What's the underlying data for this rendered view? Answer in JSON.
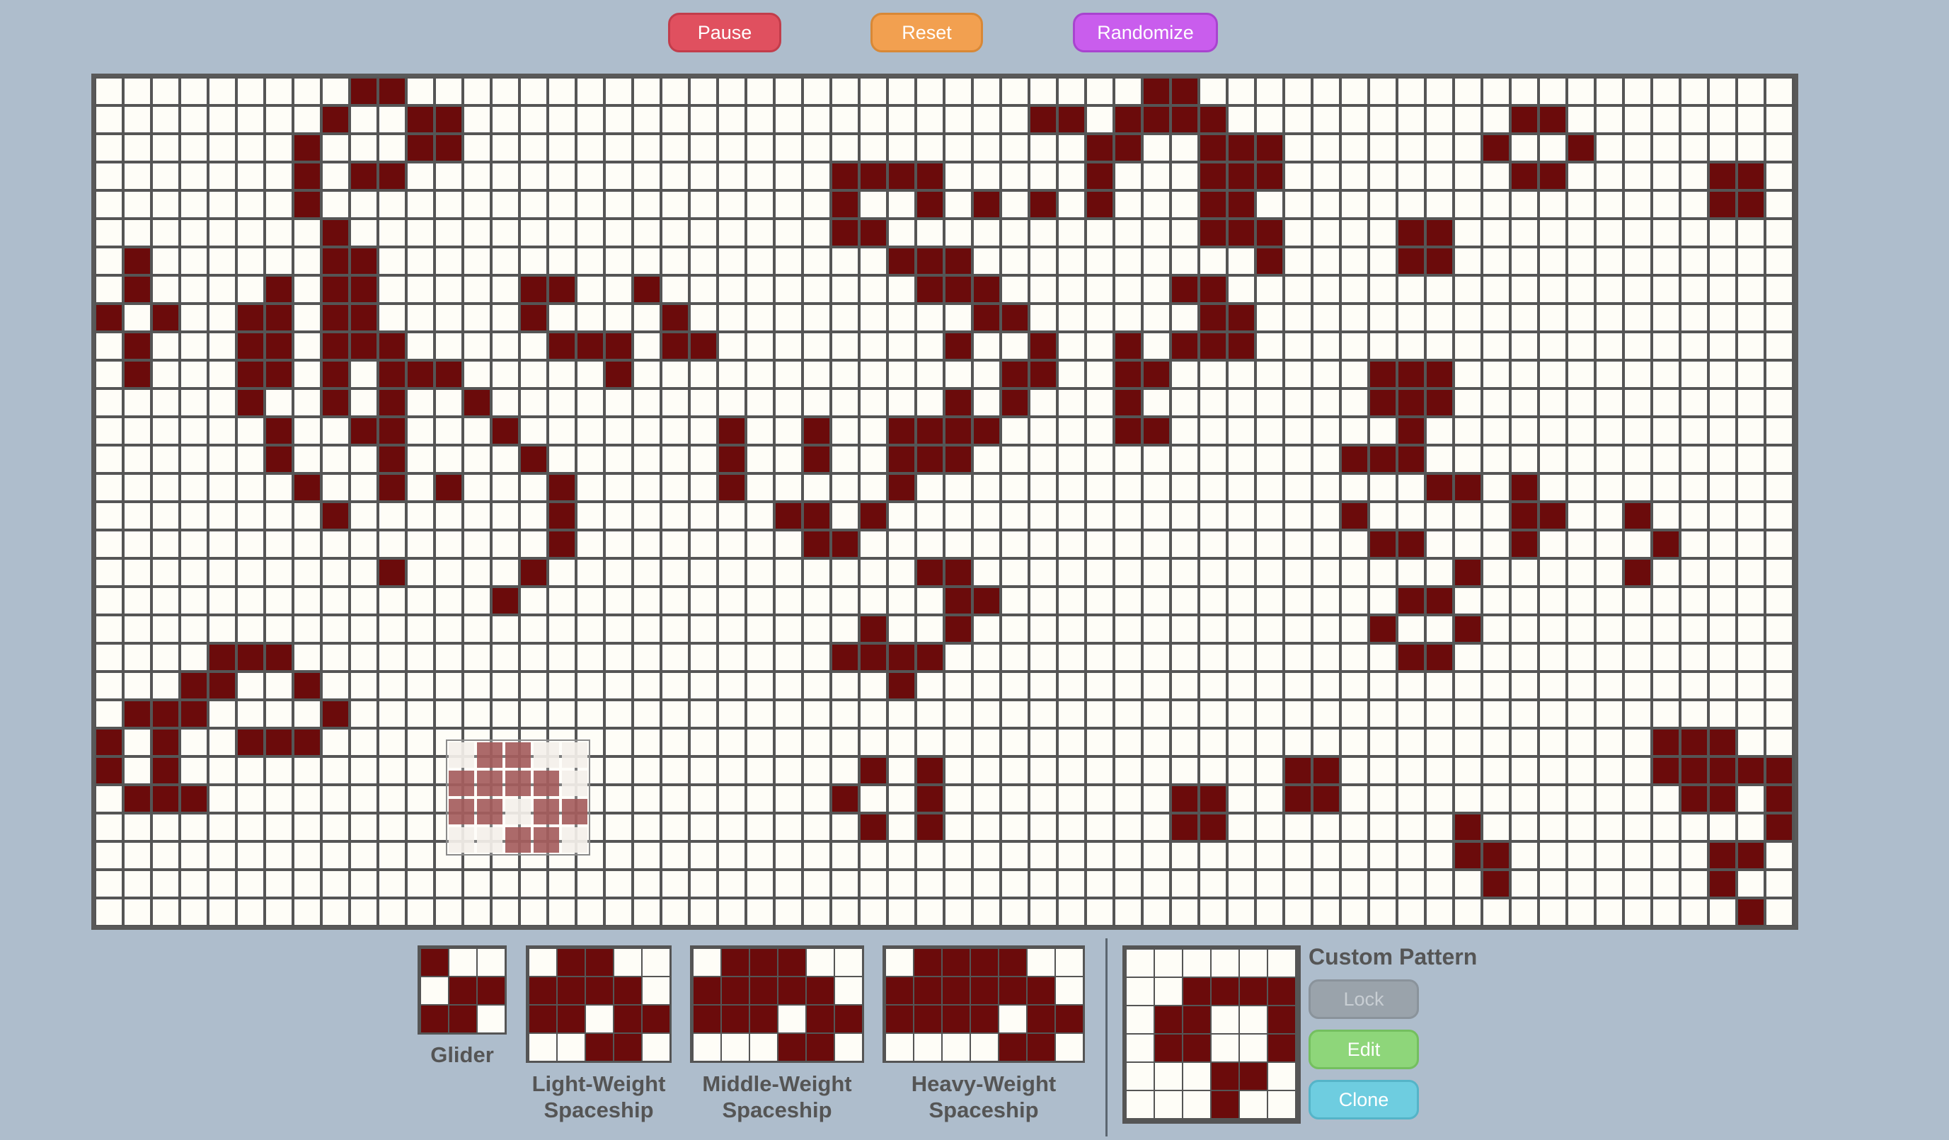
{
  "controls": {
    "pause_label": "Pause",
    "reset_label": "Reset",
    "randomize_label": "Randomize"
  },
  "colors": {
    "alive": "#6b0b0b",
    "dead": "#fefdf7",
    "grid": "#555555",
    "background": "#aebdcc"
  },
  "board": {
    "cols": 60,
    "rows": 30,
    "alive": [
      [
        0,
        9
      ],
      [
        0,
        10
      ],
      [
        0,
        37
      ],
      [
        0,
        38
      ],
      [
        1,
        8
      ],
      [
        1,
        11
      ],
      [
        1,
        12
      ],
      [
        1,
        33
      ],
      [
        1,
        34
      ],
      [
        1,
        36
      ],
      [
        1,
        37
      ],
      [
        1,
        38
      ],
      [
        1,
        39
      ],
      [
        1,
        50
      ],
      [
        1,
        51
      ],
      [
        2,
        7
      ],
      [
        2,
        11
      ],
      [
        2,
        12
      ],
      [
        2,
        35
      ],
      [
        2,
        36
      ],
      [
        2,
        39
      ],
      [
        2,
        40
      ],
      [
        2,
        41
      ],
      [
        2,
        49
      ],
      [
        2,
        52
      ],
      [
        3,
        7
      ],
      [
        3,
        9
      ],
      [
        3,
        10
      ],
      [
        3,
        26
      ],
      [
        3,
        27
      ],
      [
        3,
        28
      ],
      [
        3,
        29
      ],
      [
        3,
        35
      ],
      [
        3,
        39
      ],
      [
        3,
        40
      ],
      [
        3,
        41
      ],
      [
        3,
        50
      ],
      [
        3,
        51
      ],
      [
        3,
        57
      ],
      [
        3,
        58
      ],
      [
        4,
        7
      ],
      [
        4,
        26
      ],
      [
        4,
        29
      ],
      [
        4,
        31
      ],
      [
        4,
        33
      ],
      [
        4,
        35
      ],
      [
        4,
        39
      ],
      [
        4,
        40
      ],
      [
        4,
        57
      ],
      [
        4,
        58
      ],
      [
        5,
        8
      ],
      [
        5,
        26
      ],
      [
        5,
        27
      ],
      [
        5,
        39
      ],
      [
        5,
        40
      ],
      [
        5,
        41
      ],
      [
        5,
        46
      ],
      [
        5,
        47
      ],
      [
        6,
        1
      ],
      [
        6,
        8
      ],
      [
        6,
        9
      ],
      [
        6,
        28
      ],
      [
        6,
        29
      ],
      [
        6,
        30
      ],
      [
        6,
        41
      ],
      [
        6,
        46
      ],
      [
        6,
        47
      ],
      [
        7,
        1
      ],
      [
        7,
        6
      ],
      [
        7,
        8
      ],
      [
        7,
        9
      ],
      [
        7,
        15
      ],
      [
        7,
        16
      ],
      [
        7,
        19
      ],
      [
        7,
        29
      ],
      [
        7,
        30
      ],
      [
        7,
        31
      ],
      [
        7,
        38
      ],
      [
        7,
        39
      ],
      [
        8,
        0
      ],
      [
        8,
        2
      ],
      [
        8,
        5
      ],
      [
        8,
        6
      ],
      [
        8,
        8
      ],
      [
        8,
        9
      ],
      [
        8,
        15
      ],
      [
        8,
        20
      ],
      [
        8,
        31
      ],
      [
        8,
        32
      ],
      [
        8,
        39
      ],
      [
        8,
        40
      ],
      [
        9,
        1
      ],
      [
        9,
        5
      ],
      [
        9,
        6
      ],
      [
        9,
        8
      ],
      [
        9,
        9
      ],
      [
        9,
        10
      ],
      [
        9,
        16
      ],
      [
        9,
        17
      ],
      [
        9,
        18
      ],
      [
        9,
        20
      ],
      [
        9,
        21
      ],
      [
        9,
        30
      ],
      [
        9,
        33
      ],
      [
        9,
        36
      ],
      [
        9,
        38
      ],
      [
        9,
        39
      ],
      [
        9,
        40
      ],
      [
        10,
        1
      ],
      [
        10,
        5
      ],
      [
        10,
        6
      ],
      [
        10,
        8
      ],
      [
        10,
        10
      ],
      [
        10,
        11
      ],
      [
        10,
        12
      ],
      [
        10,
        18
      ],
      [
        10,
        32
      ],
      [
        10,
        33
      ],
      [
        10,
        36
      ],
      [
        10,
        37
      ],
      [
        10,
        45
      ],
      [
        10,
        46
      ],
      [
        10,
        47
      ],
      [
        11,
        5
      ],
      [
        11,
        8
      ],
      [
        11,
        10
      ],
      [
        11,
        13
      ],
      [
        11,
        30
      ],
      [
        11,
        32
      ],
      [
        11,
        36
      ],
      [
        11,
        45
      ],
      [
        11,
        46
      ],
      [
        11,
        47
      ],
      [
        12,
        6
      ],
      [
        12,
        9
      ],
      [
        12,
        10
      ],
      [
        12,
        14
      ],
      [
        12,
        22
      ],
      [
        12,
        25
      ],
      [
        12,
        28
      ],
      [
        12,
        29
      ],
      [
        12,
        30
      ],
      [
        12,
        31
      ],
      [
        12,
        36
      ],
      [
        12,
        37
      ],
      [
        12,
        46
      ],
      [
        13,
        6
      ],
      [
        13,
        10
      ],
      [
        13,
        15
      ],
      [
        13,
        22
      ],
      [
        13,
        25
      ],
      [
        13,
        28
      ],
      [
        13,
        29
      ],
      [
        13,
        30
      ],
      [
        13,
        44
      ],
      [
        13,
        45
      ],
      [
        13,
        46
      ],
      [
        14,
        7
      ],
      [
        14,
        10
      ],
      [
        14,
        12
      ],
      [
        14,
        16
      ],
      [
        14,
        22
      ],
      [
        14,
        28
      ],
      [
        14,
        47
      ],
      [
        14,
        48
      ],
      [
        14,
        50
      ],
      [
        15,
        8
      ],
      [
        15,
        16
      ],
      [
        15,
        24
      ],
      [
        15,
        25
      ],
      [
        15,
        27
      ],
      [
        15,
        44
      ],
      [
        15,
        50
      ],
      [
        15,
        51
      ],
      [
        15,
        54
      ],
      [
        16,
        16
      ],
      [
        16,
        25
      ],
      [
        16,
        26
      ],
      [
        16,
        45
      ],
      [
        16,
        46
      ],
      [
        16,
        50
      ],
      [
        16,
        55
      ],
      [
        17,
        10
      ],
      [
        17,
        15
      ],
      [
        17,
        29
      ],
      [
        17,
        30
      ],
      [
        17,
        48
      ],
      [
        17,
        54
      ],
      [
        18,
        14
      ],
      [
        18,
        30
      ],
      [
        18,
        31
      ],
      [
        18,
        46
      ],
      [
        18,
        47
      ],
      [
        19,
        27
      ],
      [
        19,
        30
      ],
      [
        19,
        45
      ],
      [
        19,
        48
      ],
      [
        20,
        4
      ],
      [
        20,
        5
      ],
      [
        20,
        6
      ],
      [
        20,
        26
      ],
      [
        20,
        27
      ],
      [
        20,
        28
      ],
      [
        20,
        29
      ],
      [
        20,
        46
      ],
      [
        20,
        47
      ],
      [
        21,
        3
      ],
      [
        21,
        4
      ],
      [
        21,
        7
      ],
      [
        21,
        28
      ],
      [
        22,
        1
      ],
      [
        22,
        2
      ],
      [
        22,
        3
      ],
      [
        22,
        8
      ],
      [
        23,
        0
      ],
      [
        23,
        2
      ],
      [
        23,
        5
      ],
      [
        23,
        6
      ],
      [
        23,
        7
      ],
      [
        23,
        55
      ],
      [
        23,
        56
      ],
      [
        23,
        57
      ],
      [
        24,
        0
      ],
      [
        24,
        2
      ],
      [
        24,
        27
      ],
      [
        24,
        29
      ],
      [
        24,
        42
      ],
      [
        24,
        43
      ],
      [
        24,
        55
      ],
      [
        24,
        56
      ],
      [
        24,
        57
      ],
      [
        24,
        58
      ],
      [
        24,
        59
      ],
      [
        25,
        1
      ],
      [
        25,
        2
      ],
      [
        25,
        3
      ],
      [
        25,
        26
      ],
      [
        25,
        29
      ],
      [
        25,
        38
      ],
      [
        25,
        39
      ],
      [
        25,
        42
      ],
      [
        25,
        43
      ],
      [
        25,
        56
      ],
      [
        25,
        57
      ],
      [
        25,
        59
      ],
      [
        26,
        27
      ],
      [
        26,
        29
      ],
      [
        26,
        38
      ],
      [
        26,
        39
      ],
      [
        26,
        48
      ],
      [
        26,
        59
      ],
      [
        27,
        48
      ],
      [
        27,
        49
      ],
      [
        27,
        57
      ],
      [
        27,
        58
      ],
      [
        28,
        49
      ],
      [
        28,
        57
      ],
      [
        29,
        58
      ]
    ]
  },
  "ghost": {
    "rows": 4,
    "cols": 5,
    "alive": [
      [
        0,
        1
      ],
      [
        0,
        2
      ],
      [
        1,
        0
      ],
      [
        1,
        1
      ],
      [
        1,
        2
      ],
      [
        1,
        3
      ],
      [
        2,
        0
      ],
      [
        2,
        1
      ],
      [
        2,
        3
      ],
      [
        2,
        4
      ],
      [
        3,
        2
      ],
      [
        3,
        3
      ]
    ]
  },
  "patterns": [
    {
      "id": "glider",
      "label_lines": [
        "Glider"
      ],
      "rows": 3,
      "cols": 3,
      "alive": [
        [
          0,
          0
        ],
        [
          1,
          1
        ],
        [
          1,
          2
        ],
        [
          2,
          0
        ],
        [
          2,
          1
        ]
      ]
    },
    {
      "id": "lwss",
      "label_lines": [
        "Light-Weight",
        "Spaceship"
      ],
      "rows": 4,
      "cols": 5,
      "alive": [
        [
          0,
          1
        ],
        [
          0,
          2
        ],
        [
          1,
          0
        ],
        [
          1,
          1
        ],
        [
          1,
          2
        ],
        [
          1,
          3
        ],
        [
          2,
          0
        ],
        [
          2,
          1
        ],
        [
          2,
          3
        ],
        [
          2,
          4
        ],
        [
          3,
          2
        ],
        [
          3,
          3
        ]
      ]
    },
    {
      "id": "mwss",
      "label_lines": [
        "Middle-Weight",
        "Spaceship"
      ],
      "rows": 4,
      "cols": 6,
      "alive": [
        [
          0,
          1
        ],
        [
          0,
          2
        ],
        [
          0,
          3
        ],
        [
          1,
          0
        ],
        [
          1,
          1
        ],
        [
          1,
          2
        ],
        [
          1,
          3
        ],
        [
          1,
          4
        ],
        [
          2,
          0
        ],
        [
          2,
          1
        ],
        [
          2,
          2
        ],
        [
          2,
          4
        ],
        [
          2,
          5
        ],
        [
          3,
          3
        ],
        [
          3,
          4
        ]
      ]
    },
    {
      "id": "hwss",
      "label_lines": [
        "Heavy-Weight",
        "Spaceship"
      ],
      "rows": 4,
      "cols": 7,
      "alive": [
        [
          0,
          1
        ],
        [
          0,
          2
        ],
        [
          0,
          3
        ],
        [
          0,
          4
        ],
        [
          1,
          0
        ],
        [
          1,
          1
        ],
        [
          1,
          2
        ],
        [
          1,
          3
        ],
        [
          1,
          4
        ],
        [
          1,
          5
        ],
        [
          2,
          0
        ],
        [
          2,
          1
        ],
        [
          2,
          2
        ],
        [
          2,
          3
        ],
        [
          2,
          5
        ],
        [
          2,
          6
        ],
        [
          3,
          4
        ],
        [
          3,
          5
        ]
      ]
    }
  ],
  "custom": {
    "title": "Custom Pattern",
    "lock_label": "Lock",
    "edit_label": "Edit",
    "clone_label": "Clone",
    "rows": 6,
    "cols": 6,
    "alive": [
      [
        1,
        2
      ],
      [
        1,
        3
      ],
      [
        1,
        4
      ],
      [
        1,
        5
      ],
      [
        2,
        1
      ],
      [
        2,
        2
      ],
      [
        2,
        5
      ],
      [
        3,
        1
      ],
      [
        3,
        2
      ],
      [
        3,
        5
      ],
      [
        4,
        3
      ],
      [
        4,
        4
      ],
      [
        5,
        3
      ]
    ]
  }
}
